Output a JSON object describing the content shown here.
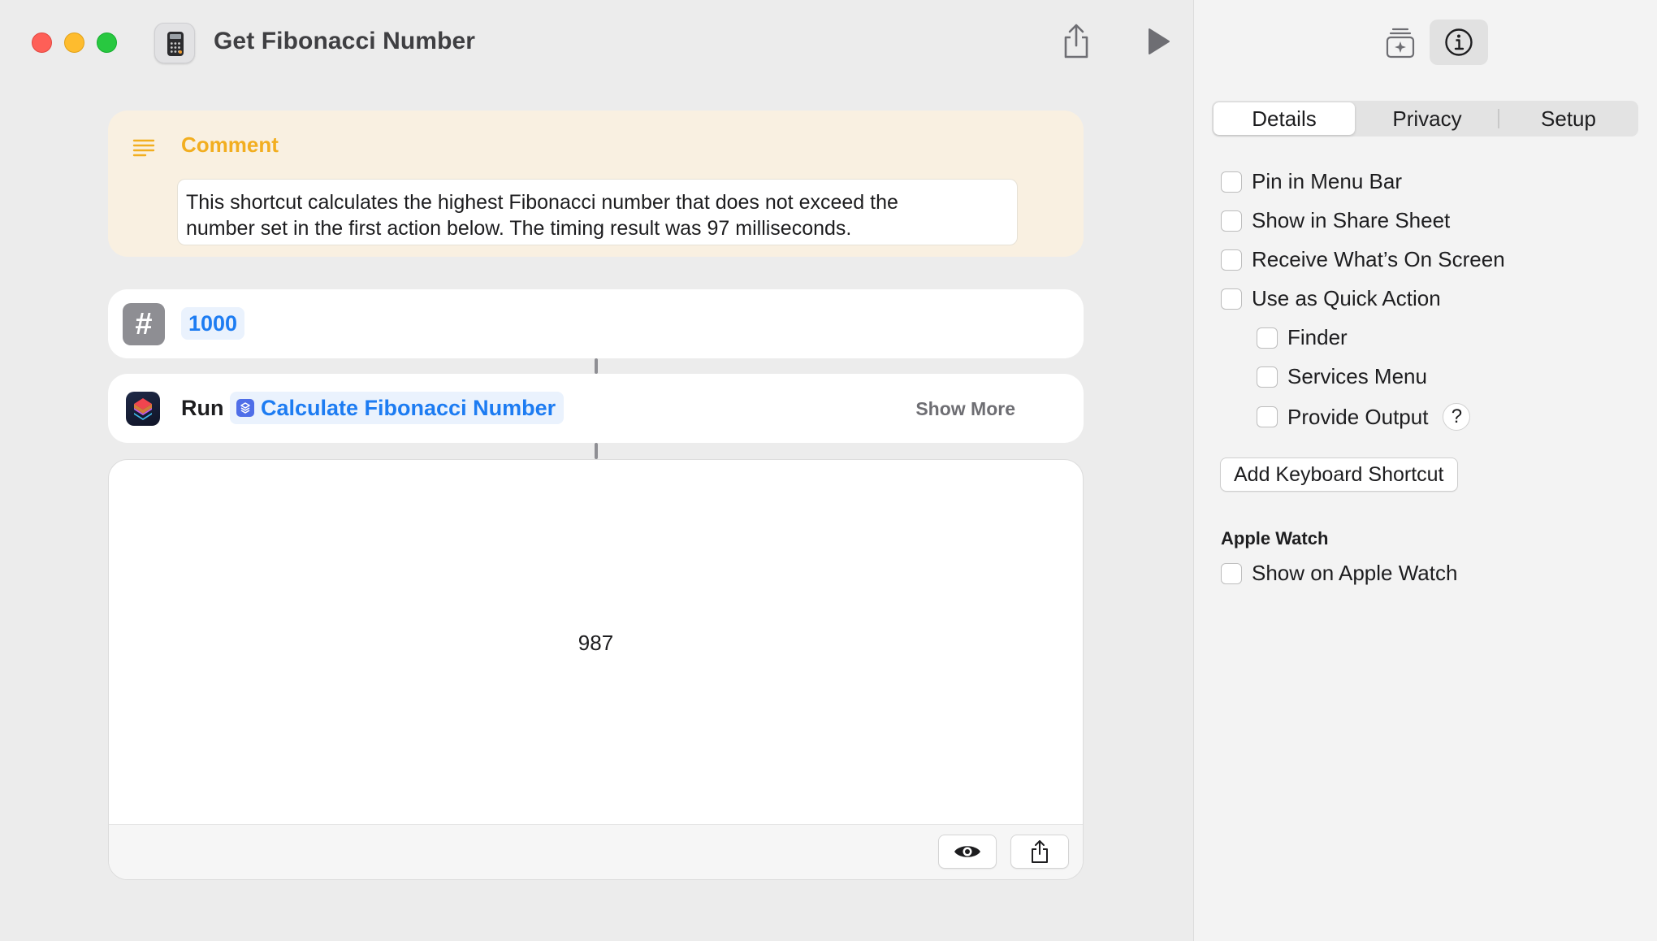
{
  "window": {
    "title": "Get Fibonacci Number"
  },
  "comment": {
    "title": "Comment",
    "text_line1": "This shortcut calculates the highest Fibonacci number that does not exceed the",
    "text_line2": "number set in the first action below. The timing result was  97 milliseconds."
  },
  "number_action": {
    "symbol": "#",
    "value": "1000"
  },
  "run_action": {
    "label": "Run",
    "shortcut_name": "Calculate Fibonacci Number",
    "show_more": "Show More"
  },
  "result": {
    "value": "987"
  },
  "sidebar": {
    "tabs": [
      "Details",
      "Privacy",
      "Setup"
    ],
    "selected_tab": "Details",
    "options": [
      {
        "label": "Pin in Menu Bar",
        "checked": false
      },
      {
        "label": "Show in Share Sheet",
        "checked": false
      },
      {
        "label": "Receive What’s On Screen",
        "checked": false
      },
      {
        "label": "Use as Quick Action",
        "checked": false
      }
    ],
    "quick_action_options": [
      {
        "label": "Finder",
        "checked": false
      },
      {
        "label": "Services Menu",
        "checked": false
      },
      {
        "label": "Provide Output",
        "checked": false
      }
    ],
    "help_symbol": "?",
    "keyboard_shortcut_button": "Add Keyboard Shortcut",
    "apple_watch": {
      "heading": "Apple Watch",
      "option": {
        "label": "Show on Apple Watch",
        "checked": false
      }
    }
  },
  "icons": {
    "app": "calculator-icon",
    "share": "share-icon",
    "play": "play-icon",
    "add_to_dock": "add-widget-icon",
    "info": "info-icon",
    "comment": "text-lines-icon",
    "quicklook": "eye-icon"
  },
  "colors": {
    "accent_blue": "#1d7cf2",
    "comment_yellow": "#f2ae20",
    "comment_bg": "#f9f0e1",
    "close": "#fe5f57",
    "minimize": "#febc2e",
    "maximize": "#28c840"
  }
}
